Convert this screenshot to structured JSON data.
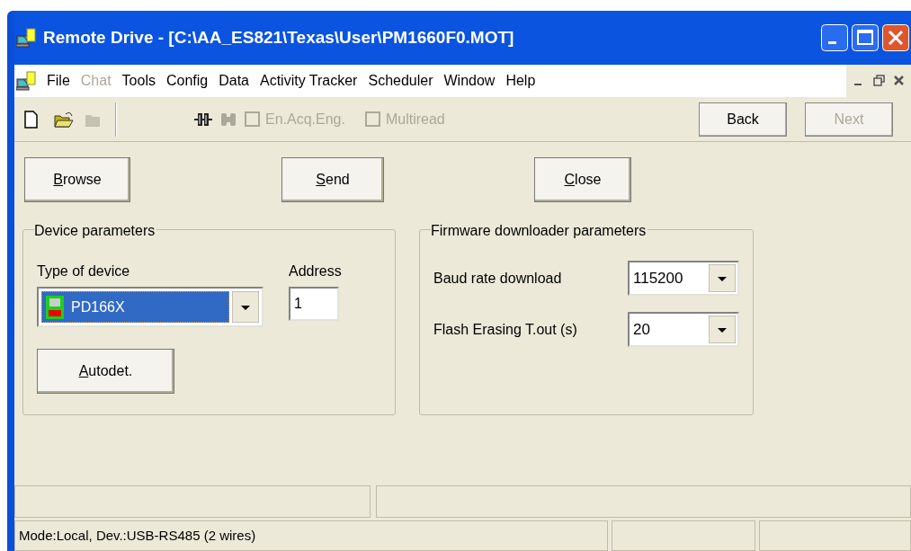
{
  "window": {
    "title": "Remote Drive - [C:\\AA_ES821\\Texas\\User\\PM1660F0.MOT]"
  },
  "menu": [
    {
      "label": "File",
      "disabled": false
    },
    {
      "label": "Chat",
      "disabled": true
    },
    {
      "label": "Tools",
      "disabled": false
    },
    {
      "label": "Config",
      "disabled": false
    },
    {
      "label": "Data",
      "disabled": false
    },
    {
      "label": "Activity Tracker",
      "disabled": false
    },
    {
      "label": "Scheduler",
      "disabled": false
    },
    {
      "label": "Window",
      "disabled": false
    },
    {
      "label": "Help",
      "disabled": false
    }
  ],
  "toolbar": {
    "tools": [
      {
        "kind": "new",
        "disabled": false
      },
      {
        "kind": "open",
        "disabled": false
      },
      {
        "kind": "folder",
        "disabled": true
      }
    ],
    "connect": [
      {
        "kind": "connect",
        "disabled": false
      },
      {
        "kind": "disconnect",
        "disabled": true
      }
    ],
    "checkboxes": [
      {
        "label": "En.Acq.Eng.",
        "checked": false,
        "disabled": true
      },
      {
        "label": "Multiread",
        "checked": false,
        "disabled": true
      }
    ],
    "nav_buttons": [
      {
        "label": "Back",
        "disabled": false
      },
      {
        "label": "Next",
        "disabled": true
      }
    ]
  },
  "actions": [
    {
      "label_parts": [
        "B",
        "rowse"
      ]
    },
    {
      "label_parts": [
        "S",
        "end"
      ]
    },
    {
      "label_parts": [
        "C",
        "lose"
      ]
    }
  ],
  "device_parameters": {
    "title": "Device parameters",
    "type_label": "Type of device",
    "type_value": "PD166X",
    "address_label": "Address",
    "address_value": "1",
    "autodetect": {
      "label_parts": [
        "A",
        "utodet."
      ]
    }
  },
  "firmware_parameters": {
    "title": "Firmware downloader parameters",
    "fields": [
      {
        "label": "Baud rate download",
        "value": "115200"
      },
      {
        "label": "Flash Erasing T.out (s)",
        "value": "20"
      }
    ]
  },
  "status_bar": {
    "text": "Mode:Local, Dev.:USB-RS485 (2 wires)"
  }
}
